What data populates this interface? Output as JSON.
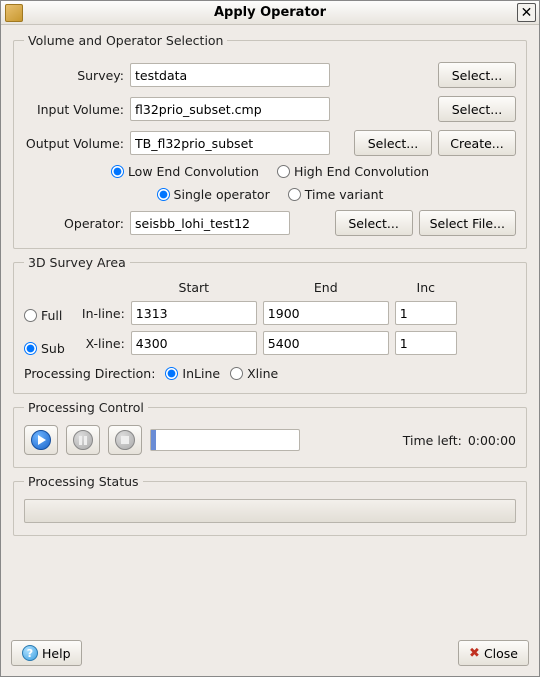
{
  "window": {
    "title": "Apply Operator"
  },
  "vol": {
    "legend": "Volume and Operator Selection",
    "survey_label": "Survey:",
    "survey_value": "testdata",
    "input_label": "Input Volume:",
    "input_value": "fl32prio_subset.cmp",
    "output_label": "Output Volume:",
    "output_value": "TB_fl32prio_subset",
    "select_btn": "Select...",
    "create_btn": "Create...",
    "conv_low": "Low End Convolution",
    "conv_high": "High End Convolution",
    "op_single": "Single operator",
    "op_tv": "Time variant",
    "operator_label": "Operator:",
    "operator_value": "seisbb_lohi_test12",
    "select_file_btn": "Select File..."
  },
  "area": {
    "legend": "3D Survey Area",
    "full": "Full",
    "sub": "Sub",
    "start": "Start",
    "end": "End",
    "inc": "Inc",
    "inline_label": "In-line:",
    "inline_start": "1313",
    "inline_end": "1900",
    "inline_inc": "1",
    "xline_label": "X-line:",
    "xline_start": "4300",
    "xline_end": "5400",
    "xline_inc": "1",
    "proc_dir_label": "Processing Direction:",
    "pd_inline": "InLine",
    "pd_xline": "Xline"
  },
  "pc": {
    "legend": "Processing Control",
    "time_label": "Time left:",
    "time_value": "0:00:00"
  },
  "ps": {
    "legend": "Processing Status"
  },
  "footer": {
    "help": "Help",
    "close": "Close"
  }
}
